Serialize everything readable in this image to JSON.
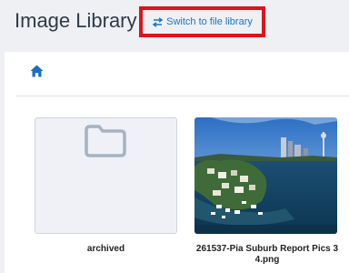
{
  "header": {
    "title": "Image Library",
    "switch_label": "Switch to file library",
    "switch_icon": "swap-arrows-icon",
    "highlight_color": "#e0121c",
    "link_color": "#1a73c9"
  },
  "breadcrumb": {
    "home_icon": "home-icon"
  },
  "items": [
    {
      "type": "folder",
      "label": "archived",
      "icon": "folder-icon"
    },
    {
      "type": "image",
      "label": "261537-Pia Suburb Report Pics 3 4.png"
    }
  ]
}
